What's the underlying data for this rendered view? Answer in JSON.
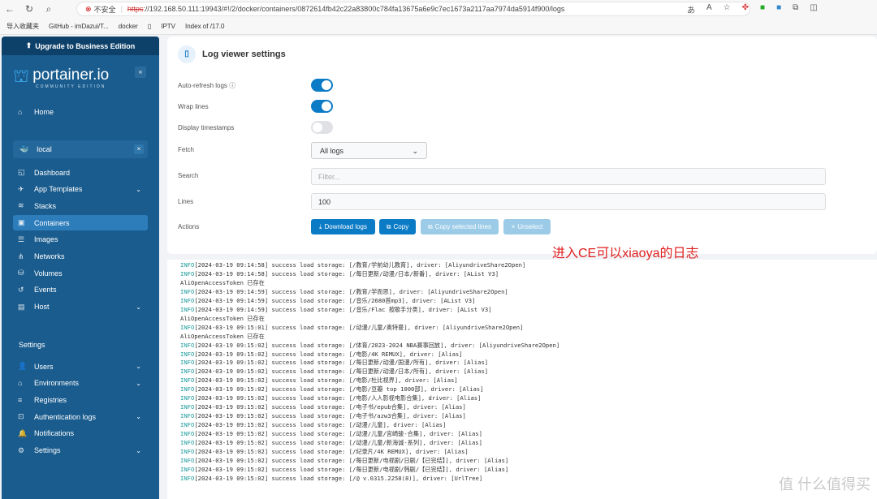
{
  "browser": {
    "security": "不安全",
    "url_scheme": "https",
    "url_rest": "://192.168.50.111:19943/#!/2/docker/containers/0872614fb42c22a83800c784fa13675a6e9c7ec1673a2117aa7974da5914f900/logs",
    "bookmarks": [
      "导入收藏夹",
      "GitHub - imDazui/T...",
      "docker",
      "",
      "IPTV",
      "Index of /17.0"
    ]
  },
  "sidebar": {
    "upgrade": "Upgrade to Business Edition",
    "logo_name": "portainer.io",
    "logo_sub": "COMMUNITY EDITION",
    "home": "Home",
    "env": "local",
    "items": [
      {
        "label": "Dashboard",
        "icon": "dashboard-icon"
      },
      {
        "label": "App Templates",
        "icon": "rocket-icon",
        "chev": true
      },
      {
        "label": "Stacks",
        "icon": "layers-icon"
      },
      {
        "label": "Containers",
        "icon": "box-icon",
        "active": true
      },
      {
        "label": "Images",
        "icon": "list-icon"
      },
      {
        "label": "Networks",
        "icon": "network-icon"
      },
      {
        "label": "Volumes",
        "icon": "database-icon"
      },
      {
        "label": "Events",
        "icon": "history-icon"
      },
      {
        "label": "Host",
        "icon": "server-icon",
        "chev": true
      }
    ],
    "settings_header": "Settings",
    "settings": [
      {
        "label": "Users",
        "chev": true
      },
      {
        "label": "Environments",
        "chev": true
      },
      {
        "label": "Registries"
      },
      {
        "label": "Authentication logs",
        "chev": true
      },
      {
        "label": "Notifications"
      },
      {
        "label": "Settings",
        "chev": true
      }
    ]
  },
  "panel": {
    "title": "Log viewer settings",
    "auto_refresh": "Auto-refresh logs",
    "auto_refresh_on": true,
    "wrap": "Wrap lines",
    "wrap_on": true,
    "timestamps": "Display timestamps",
    "timestamps_on": false,
    "fetch": "Fetch",
    "fetch_value": "All logs",
    "search": "Search",
    "search_placeholder": "Filter...",
    "lines": "Lines",
    "lines_value": "100",
    "actions": "Actions",
    "download": "Download logs",
    "copy": "Copy",
    "copy_selected": "Copy selected lines",
    "unselect": "Unselect"
  },
  "annotation": "进入CE可以xiaoya的日志",
  "watermark": "值 什么值得买",
  "logs": [
    [
      "INFO",
      "[2024-03-19 09:14:58] success load storage: [/教育/学前幼儿教育], driver: [AliyundriveShare2Open]"
    ],
    [
      "INFO",
      "[2024-03-19 09:14:58] success load storage: [/每日更新/动漫/日本/新番], driver: [AList V3]"
    ],
    [
      "",
      "AliOpenAccessToken 已存在"
    ],
    [
      "INFO",
      "[2024-03-19 09:14:59] success load storage: [/教育/学而思], driver: [AliyundriveShare2Open]"
    ],
    [
      "INFO",
      "[2024-03-19 09:14:59] success load storage: [/音乐/2680首mp3], driver: [AList V3]"
    ],
    [
      "INFO",
      "[2024-03-19 09:14:59] success load storage: [/音乐/Flac 按歌手分类], driver: [AList V3]"
    ],
    [
      "",
      "AliOpenAccessToken 已存在"
    ],
    [
      "INFO",
      "[2024-03-19 09:15:01] success load storage: [/动漫/儿童/奥特曼], driver: [AliyundriveShare2Open]"
    ],
    [
      "",
      "AliOpenAccessToken 已存在"
    ],
    [
      "INFO",
      "[2024-03-19 09:15:02] success load storage: [/体育/2023-2024 NBA赛事回放], driver: [AliyundriveShare2Open]"
    ],
    [
      "INFO",
      "[2024-03-19 09:15:02] success load storage: [/电影/4K REMUX], driver: [Alias]"
    ],
    [
      "INFO",
      "[2024-03-19 09:15:02] success load storage: [/每日更新/动漫/国漫/所有], driver: [Alias]"
    ],
    [
      "INFO",
      "[2024-03-19 09:15:02] success load storage: [/每日更新/动漫/日本/所有], driver: [Alias]"
    ],
    [
      "INFO",
      "[2024-03-19 09:15:02] success load storage: [/电影/杜比视界], driver: [Alias]"
    ],
    [
      "INFO",
      "[2024-03-19 09:15:02] success load storage: [/电影/豆瓣 top 1000部], driver: [Alias]"
    ],
    [
      "INFO",
      "[2024-03-19 09:15:02] success load storage: [/电影/人人影视电影合集], driver: [Alias]"
    ],
    [
      "INFO",
      "[2024-03-19 09:15:02] success load storage: [/电子书/epub合集], driver: [Alias]"
    ],
    [
      "INFO",
      "[2024-03-19 09:15:02] success load storage: [/电子书/azw3合集], driver: [Alias]"
    ],
    [
      "INFO",
      "[2024-03-19 09:15:02] success load storage: [/动漫/儿童], driver: [Alias]"
    ],
    [
      "INFO",
      "[2024-03-19 09:15:02] success load storage: [/动漫/儿童/宫崎骏-合集], driver: [Alias]"
    ],
    [
      "INFO",
      "[2024-03-19 09:15:02] success load storage: [/动漫/儿童/新海诚-系列], driver: [Alias]"
    ],
    [
      "INFO",
      "[2024-03-19 09:15:02] success load storage: [/纪录片/4K REMUX], driver: [Alias]"
    ],
    [
      "INFO",
      "[2024-03-19 09:15:02] success load storage: [/每日更新/电视剧/日剧/【已完结】], driver: [Alias]"
    ],
    [
      "INFO",
      "[2024-03-19 09:15:02] success load storage: [/每日更新/电视剧/韩剧/【已完结】], driver: [Alias]"
    ],
    [
      "INFO",
      "[2024-03-19 09:15:02] success load storage: [/@ v.0315.2258(8)], driver: [UrlTree]"
    ]
  ]
}
